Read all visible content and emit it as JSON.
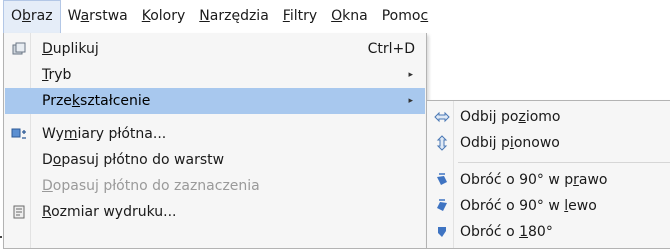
{
  "menubar": {
    "items": [
      {
        "pre": "O",
        "acc": "b",
        "post": "raz"
      },
      {
        "pre": "W",
        "acc": "a",
        "post": "rstwa"
      },
      {
        "pre": "",
        "acc": "K",
        "post": "olory"
      },
      {
        "pre": "",
        "acc": "N",
        "post": "arzędzia"
      },
      {
        "pre": "",
        "acc": "F",
        "post": "iltry"
      },
      {
        "pre": "",
        "acc": "O",
        "post": "kna"
      },
      {
        "pre": "Pomo",
        "acc": "c",
        "post": ""
      }
    ]
  },
  "image_menu": {
    "items": [
      {
        "pre": "",
        "acc": "D",
        "post": "uplikuj",
        "shortcut": "Ctrl+D",
        "icon": "duplicate-icon"
      },
      {
        "pre": "",
        "acc": "T",
        "post": "ryb",
        "submenu_arrow": "▸"
      },
      {
        "pre": "Prze",
        "acc": "k",
        "post": "ształcenie",
        "submenu_arrow": "▸"
      },
      {
        "pre": "Wy",
        "acc": "m",
        "post": "iary płótna...",
        "icon": "canvas-size-icon"
      },
      {
        "pre": "D",
        "acc": "o",
        "post": "pasuj płótno do warstw"
      },
      {
        "pre": "",
        "acc": "D",
        "post": "opasuj płótno do zaznaczenia"
      },
      {
        "pre": "",
        "acc": "R",
        "post": "ozmiar wydruku...",
        "icon": "print-size-icon"
      }
    ]
  },
  "transform_submenu": {
    "items": [
      {
        "pre": "Odbij po",
        "acc": "z",
        "post": "iomo",
        "icon": "flip-horizontal-icon"
      },
      {
        "pre": "Odbij p",
        "acc": "i",
        "post": "onowo",
        "icon": "flip-vertical-icon"
      },
      {
        "pre": "Obróć o 90° w p",
        "acc": "r",
        "post": "awo",
        "icon": "rotate-right-icon"
      },
      {
        "pre": "Obróć o 90° w ",
        "acc": "l",
        "post": "ewo",
        "icon": "rotate-left-icon"
      },
      {
        "pre": "Obróć o ",
        "acc": "1",
        "post": "80°",
        "icon": "rotate-180-icon"
      }
    ]
  },
  "colors": {
    "highlight": "#a8c8ee",
    "menu_bg": "#f6f6f6",
    "disabled_text": "#9a9a9a"
  }
}
